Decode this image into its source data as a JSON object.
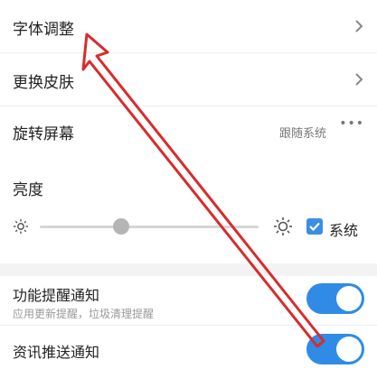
{
  "settings": {
    "font_adjust": {
      "label": "字体调整"
    },
    "skin": {
      "label": "更换皮肤"
    },
    "rotation": {
      "label": "旋转屏幕",
      "value": "跟随系统",
      "more": "•••"
    },
    "brightness": {
      "label": "亮度",
      "level": 0.37,
      "follow_system_label": "系统",
      "follow_system_checked": true
    },
    "notify_feature": {
      "label": "功能提醒通知",
      "sublabel": "应用更新提醒，垃圾清理提醒",
      "enabled": true
    },
    "notify_news": {
      "label": "资讯推送通知",
      "enabled": true
    }
  },
  "colors": {
    "accent": "#2f8be6",
    "annotation_arrow": "#d92b2b"
  },
  "icons": {
    "chevron": "chevron-right-icon",
    "brightness_low": "brightness-low-icon",
    "brightness_high": "brightness-high-icon",
    "checkbox": "checkbox-checked-icon",
    "annotation": "red-arrow-annotation"
  }
}
